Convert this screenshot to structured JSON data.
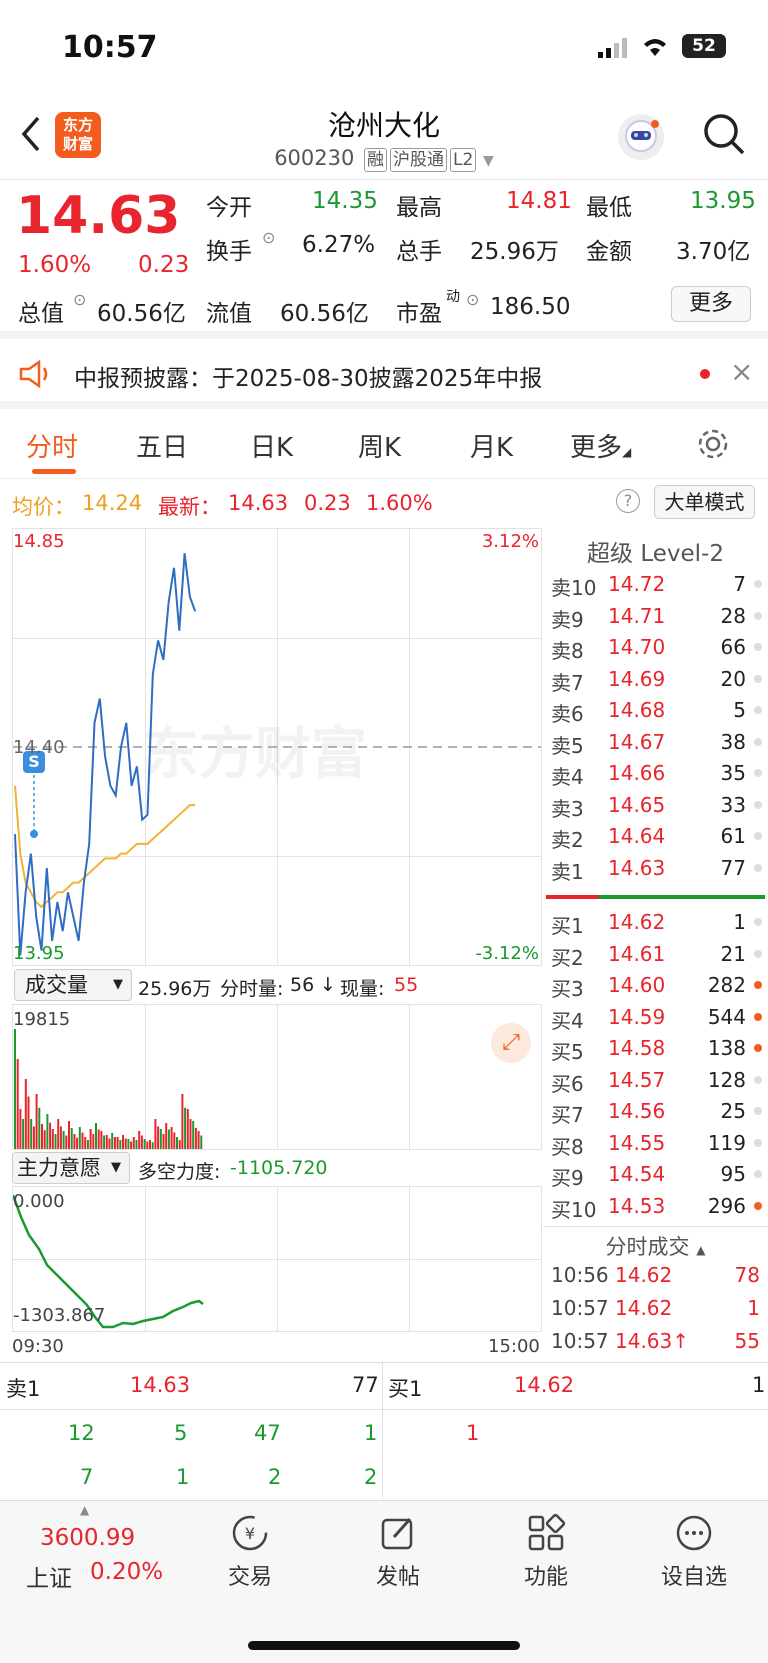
{
  "status": {
    "time": "10:57",
    "battery": "52"
  },
  "header": {
    "name": "沧州大化",
    "code": "600230",
    "tags": [
      "融",
      "沪股通",
      "L2"
    ],
    "logo": "东方财富"
  },
  "quote": {
    "price": "14.63",
    "pct": "1.60%",
    "chg": "0.23",
    "open_label": "今开",
    "open": "14.35",
    "high_label": "最高",
    "high": "14.81",
    "low_label": "最低",
    "low": "13.95",
    "turnover_label": "换手",
    "turnover": "6.27%",
    "vol_label": "总手",
    "vol": "25.96万",
    "amt_label": "金额",
    "amt": "3.70亿",
    "mcap_label": "总值",
    "mcap": "60.56亿",
    "float_label": "流值",
    "float": "60.56亿",
    "pe_label": "市盈",
    "pe_sup": "动",
    "pe": "186.50",
    "more": "更多"
  },
  "notice": {
    "text": "中报预披露：于2025-08-30披露2025年中报"
  },
  "tabs": [
    "分时",
    "五日",
    "日K",
    "周K",
    "月K",
    "更多"
  ],
  "info": {
    "avg_label": "均价：",
    "avg": "14.24",
    "latest_label": "最新：",
    "latest": "14.63",
    "chg": "0.23",
    "pct": "1.60%",
    "mode_btn": "大单模式"
  },
  "chart": {
    "y_top": "14.85",
    "y_mid": "14.40",
    "y_bot": "13.95",
    "pct_top": "3.12%",
    "pct_bot": "-3.12%",
    "watermark": "东方财富",
    "vol_selector": "成交量",
    "vol_total": "25.96万",
    "vol_tick_label": "分时量:",
    "vol_tick": "56",
    "vol_now_label": "现量:",
    "vol_now": "55",
    "vol_max": "19815",
    "ind_selector": "主力意愿",
    "ind_label": "多空力度:",
    "ind_value": "-1105.720",
    "ind_top": "0.000",
    "ind_bot": "-1303.867",
    "t_start": "09:30",
    "t_end": "15:00"
  },
  "chart_data": {
    "type": "line",
    "price": [
      14.22,
      13.97,
      14.1,
      14.18,
      14.05,
      13.98,
      14.15,
      14.0,
      14.08,
      14.02,
      14.1,
      14.05,
      14.0,
      14.12,
      14.2,
      14.45,
      14.5,
      14.38,
      14.32,
      14.3,
      14.4,
      14.45,
      14.32,
      14.36,
      14.25,
      14.26,
      14.55,
      14.62,
      14.58,
      14.7,
      14.77,
      14.64,
      14.8,
      14.71,
      14.68
    ],
    "avg": [
      14.32,
      14.18,
      14.12,
      14.1,
      14.08,
      14.07,
      14.08,
      14.09,
      14.1,
      14.1,
      14.11,
      14.12,
      14.12,
      14.13,
      14.14,
      14.15,
      14.16,
      14.17,
      14.17,
      14.17,
      14.18,
      14.18,
      14.19,
      14.2,
      14.2,
      14.2,
      14.21,
      14.22,
      14.23,
      14.24,
      14.25,
      14.26,
      14.27,
      14.28,
      14.28
    ],
    "y_range": [
      13.95,
      14.85
    ]
  },
  "orderbook": {
    "title": "超级 Level-2",
    "asks": [
      [
        "卖10",
        "14.72",
        "7"
      ],
      [
        "卖9",
        "14.71",
        "28"
      ],
      [
        "卖8",
        "14.70",
        "66"
      ],
      [
        "卖7",
        "14.69",
        "20"
      ],
      [
        "卖6",
        "14.68",
        "5"
      ],
      [
        "卖5",
        "14.67",
        "38"
      ],
      [
        "卖4",
        "14.66",
        "35"
      ],
      [
        "卖3",
        "14.65",
        "33"
      ],
      [
        "卖2",
        "14.64",
        "61"
      ],
      [
        "卖1",
        "14.63",
        "77"
      ]
    ],
    "bids": [
      [
        "买1",
        "14.62",
        "1"
      ],
      [
        "买2",
        "14.61",
        "21"
      ],
      [
        "买3",
        "14.60",
        "282"
      ],
      [
        "买4",
        "14.59",
        "544"
      ],
      [
        "买5",
        "14.58",
        "138"
      ],
      [
        "买6",
        "14.57",
        "128"
      ],
      [
        "买7",
        "14.56",
        "25"
      ],
      [
        "买8",
        "14.55",
        "119"
      ],
      [
        "买9",
        "14.54",
        "95"
      ],
      [
        "买10",
        "14.53",
        "296"
      ]
    ],
    "trades_title": "分时成交",
    "trades": [
      [
        "10:56",
        "14.62",
        "78"
      ],
      [
        "10:57",
        "14.62",
        "1"
      ],
      [
        "10:57",
        "14.63↑",
        "55"
      ]
    ]
  },
  "queue": {
    "ask_label": "卖1",
    "ask_price": "14.63",
    "ask_vol": "77",
    "bid_label": "买1",
    "bid_price": "14.62",
    "bid_vol": "1",
    "ask_q1": [
      "12",
      "5",
      "47",
      "1"
    ],
    "ask_q2": [
      "7",
      "1",
      "2",
      "2"
    ],
    "bid_q1": [
      "1"
    ]
  },
  "bottom": {
    "index_value": "3600.99",
    "index_name": "上证",
    "index_pct": "0.20%",
    "nav": [
      "交易",
      "发帖",
      "功能",
      "设自选"
    ]
  }
}
